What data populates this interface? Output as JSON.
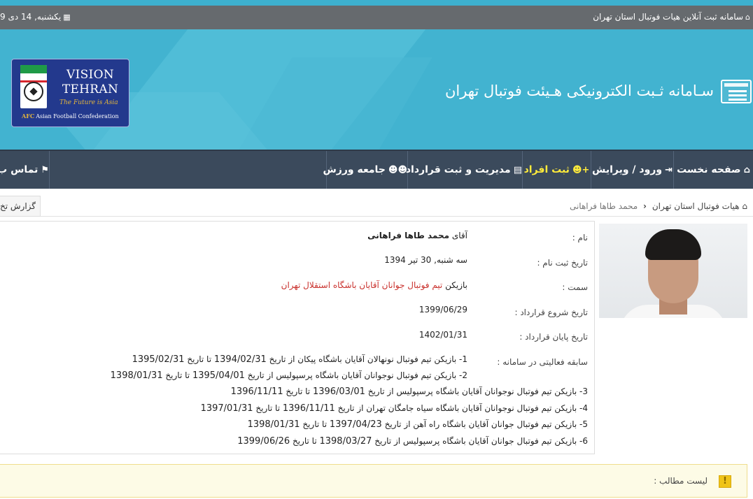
{
  "topbar": {
    "site_label": "سامانه ثبت آنلاین هیات فوتبال استان تهران",
    "home_icon": "home-icon",
    "date_text": "یکشنبه, 14 دی 9",
    "calendar_icon": "calendar-icon"
  },
  "banner": {
    "title": "سـامانه ثـبت الکترونیکی هـیئت فوتبال تهران",
    "logo": {
      "line1": "VISION",
      "line2": "TEHRAN",
      "tagline": "The Future is Asia",
      "afc_mark": "AFC",
      "afc_text": "Asian Football Confederation"
    }
  },
  "nav": {
    "items": [
      {
        "label": "صفحه نخست",
        "icon": "home-icon"
      },
      {
        "label": "ورود / ویرایش",
        "icon": "sign-in-icon"
      },
      {
        "label": "ثبت افراد",
        "icon": "user-plus-icon",
        "active": true
      },
      {
        "label": "مدیریت و ثبت قرارداد",
        "icon": "list-icon"
      },
      {
        "label": "جامعه ورزش",
        "icon": "users-icon"
      },
      {
        "label": "تماس ب",
        "icon": "flag-icon"
      }
    ]
  },
  "breadcrumb": {
    "root": "هیات فوتبال استان تهران",
    "current": "محمد طاها فراهانی"
  },
  "report_tab": "گزارش تخ",
  "profile": {
    "name_label": "نام :",
    "name_prefix": "آقای",
    "name_value": "محمد طاها فراهانی",
    "regdate_label": "تاریخ ثبت نام :",
    "regdate_value": "سه شنبه, 30 تیر 1394",
    "position_label": "سمت :",
    "position_prefix": "بازیکن",
    "position_value": "تیم فوتبال جوانان آقایان باشگاه استقلال تهران",
    "contract_start_label": "تاریخ شروع قرارداد :",
    "contract_start_value": "1399/06/29",
    "contract_end_label": "تاریخ پایان قرارداد :",
    "contract_end_value": "1402/01/31",
    "history_label": "سابقه فعالیتی در سامانه :",
    "history": [
      {
        "text": "1- بازیکن تیم فوتبال نونهالان آقایان باشگاه پیکان از تاریخ",
        "from": "1394/02/31",
        "mid": "تا تاریخ",
        "to": "1395/02/31"
      },
      {
        "text": "2- بازیکن تیم فوتبال نوجوانان آقایان باشگاه پرسپولیس از تاریخ",
        "from": "1395/04/01",
        "mid": "تا تاریخ",
        "to": "1398/01/31"
      },
      {
        "text": "3- بازیکن تیم فوتبال نوجوانان آقایان باشگاه پرسپولیس از تاریخ",
        "from": "1396/03/01",
        "mid": "تا تاریخ",
        "to": "1396/11/11"
      },
      {
        "text": "4- بازیکن تیم فوتبال نوجوانان آقایان باشگاه سیاه جامگان تهران از تاریخ",
        "from": "1396/11/11",
        "mid": "تا تاریخ",
        "to": "1397/01/31"
      },
      {
        "text": "5- بازیکن تیم فوتبال جوانان آقایان باشگاه راه آهن از تاریخ",
        "from": "1397/04/23",
        "mid": "تا تاریخ",
        "to": "1398/01/31"
      },
      {
        "text": "6- بازیکن تیم فوتبال جوانان آقایان باشگاه پرسپولیس از تاریخ",
        "from": "1398/03/27",
        "mid": "تا تاریخ",
        "to": "1399/06/26"
      }
    ]
  },
  "todo_label": "لیست مطالب :",
  "colors": {
    "banner": "#42b3d0",
    "topbar": "#666a6e",
    "navbar": "#3b4a5c",
    "nav_active": "#ffeb3b",
    "position_red": "#c9302c"
  }
}
